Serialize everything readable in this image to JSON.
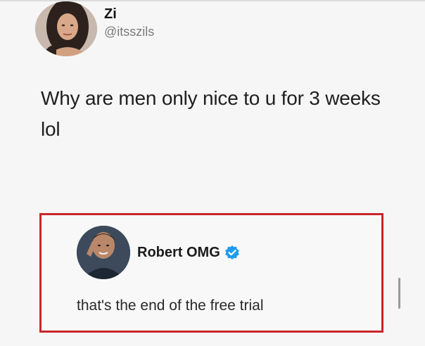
{
  "tweet": {
    "display_name": "Zi",
    "handle": "@itsszils",
    "text": "Why are men only nice to u for 3 weeks lol"
  },
  "reply": {
    "display_name": "Robert OMG",
    "text": "that's the end of the free trial",
    "verified_icon": "verified-badge-icon"
  },
  "colors": {
    "highlight_border": "#c9262b",
    "verified_blue": "#1d9bf0"
  }
}
